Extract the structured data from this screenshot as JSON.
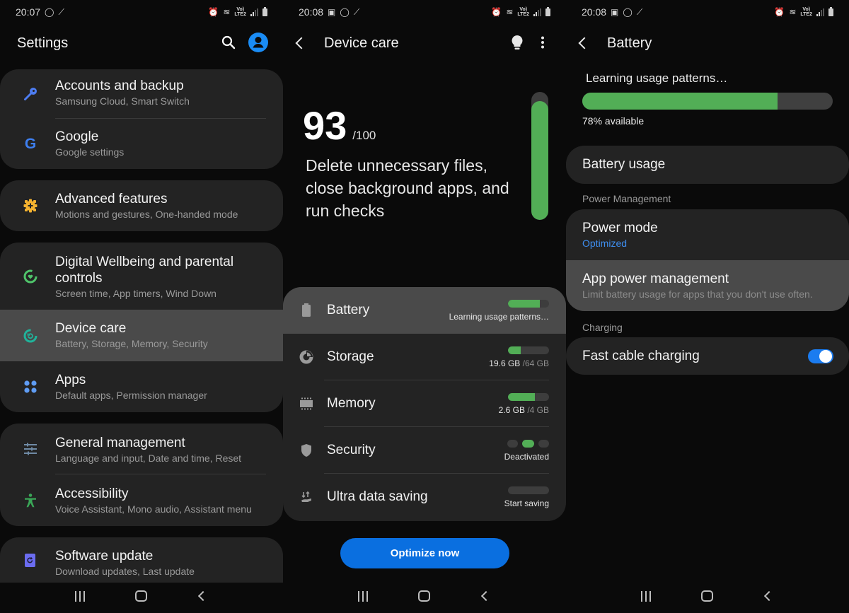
{
  "status_icons": [
    "whatsapp-icon",
    "magic-wand-icon",
    "alarm-icon",
    "wifi-icon",
    "volte-lte2-icon",
    "signal-icon",
    "battery-icon"
  ],
  "lte_label": "VoLTE2",
  "screens": {
    "settings": {
      "time": "20:07",
      "title": "Settings",
      "groups": [
        [
          {
            "title": "Accounts and backup",
            "subtitle": "Samsung Cloud, Smart Switch",
            "icon": "key-icon",
            "color": "#4d7cf0"
          },
          {
            "title": "Google",
            "subtitle": "Google settings",
            "icon": "google-icon",
            "color": "#3e7ff0"
          }
        ],
        [
          {
            "title": "Advanced features",
            "subtitle": "Motions and gestures, One-handed mode",
            "icon": "gear-plus-icon",
            "color": "#f5b330"
          }
        ],
        [
          {
            "title": "Digital Wellbeing and parental controls",
            "subtitle": "Screen time, App timers, Wind Down",
            "icon": "wellbeing-icon",
            "color": "#4fc36a"
          },
          {
            "title": "Device care",
            "subtitle": "Battery, Storage, Memory, Security",
            "icon": "device-care-icon",
            "color": "#20b39a",
            "highlighted": true
          },
          {
            "title": "Apps",
            "subtitle": "Default apps, Permission manager",
            "icon": "apps-grid-icon",
            "color": "#5f9cf3"
          }
        ],
        [
          {
            "title": "General management",
            "subtitle": "Language and input, Date and time, Reset",
            "icon": "sliders-icon",
            "color": "#6f8aa5"
          },
          {
            "title": "Accessibility",
            "subtitle": "Voice Assistant, Mono audio, Assistant menu",
            "icon": "accessibility-icon",
            "color": "#3aa657"
          }
        ],
        [
          {
            "title": "Software update",
            "subtitle": "Download updates, Last update",
            "icon": "software-update-icon",
            "color": "#6b6cf0"
          }
        ]
      ]
    },
    "device_care": {
      "time": "20:08",
      "title": "Device care",
      "score": "93",
      "score_max": "/100",
      "score_fraction": 0.93,
      "description": "Delete unnecessary files, close background apps, and run checks",
      "items": [
        {
          "label": "Battery",
          "icon": "battery-icon",
          "value": "Learning usage patterns…",
          "fill": 0.78,
          "highlighted": true
        },
        {
          "label": "Storage",
          "icon": "storage-pie-icon",
          "value_main": "19.6 GB",
          "value_dim": "/64 GB",
          "fill": 0.31
        },
        {
          "label": "Memory",
          "icon": "memory-chip-icon",
          "value_main": "2.6 GB",
          "value_dim": "/4 GB",
          "fill": 0.65
        },
        {
          "label": "Security",
          "icon": "shield-icon",
          "value": "Deactivated",
          "dots_active": 2
        },
        {
          "label": "Ultra data saving",
          "icon": "data-saving-icon",
          "value": "Start saving",
          "fill": 0
        }
      ],
      "optimize_label": "Optimize now"
    },
    "battery": {
      "time": "20:08",
      "title": "Battery",
      "learning": "Learning usage patterns…",
      "percent": 0.78,
      "available": "78% available",
      "battery_usage": "Battery usage",
      "power_section": "Power Management",
      "power_mode": "Power mode",
      "power_mode_value": "Optimized",
      "app_power": "App power management",
      "app_power_desc": "Limit battery usage for apps that you don't use often.",
      "charging_section": "Charging",
      "fast_charging": "Fast cable charging",
      "fast_charging_on": true
    }
  },
  "colors": {
    "accent_green": "#52ae56",
    "accent_blue": "#0a6fe0",
    "link_blue": "#3e8ef0"
  }
}
